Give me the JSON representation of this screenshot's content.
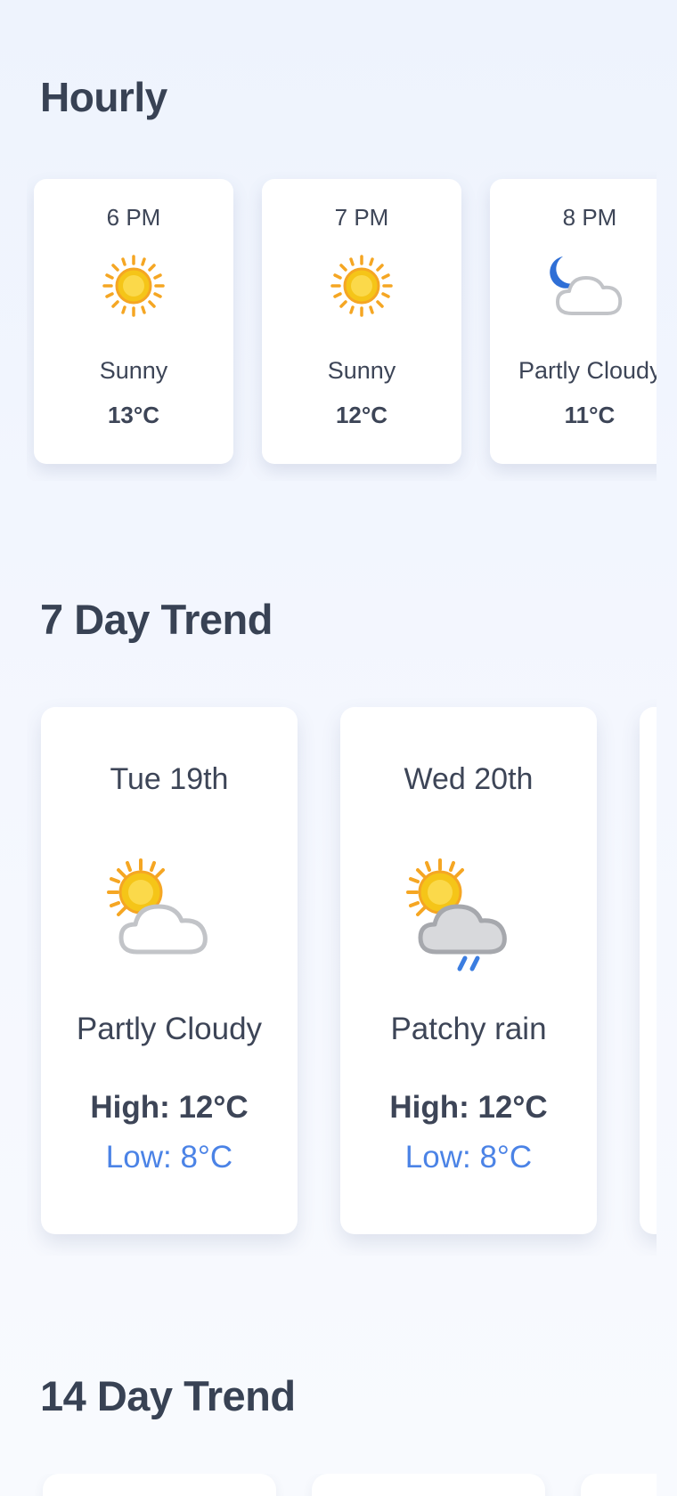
{
  "hourly": {
    "title": "Hourly",
    "items": [
      {
        "time": "6 PM",
        "condition": "Sunny",
        "temp": "13°C",
        "icon": "sun-icon"
      },
      {
        "time": "7 PM",
        "condition": "Sunny",
        "temp": "12°C",
        "icon": "sun-icon"
      },
      {
        "time": "8 PM",
        "condition": "Partly Cloudy",
        "temp": "11°C",
        "icon": "moon-cloud-icon"
      }
    ]
  },
  "seven_day": {
    "title": "7 Day Trend",
    "items": [
      {
        "date": "Tue 19th",
        "condition": "Partly Cloudy",
        "high": "High: 12°C",
        "low": "Low: 8°C",
        "icon": "sun-cloud-icon"
      },
      {
        "date": "Wed 20th",
        "condition": "Patchy rain",
        "high": "High: 12°C",
        "low": "Low: 8°C",
        "icon": "sun-cloud-rain-icon"
      }
    ]
  },
  "fourteen_day": {
    "title": "14 Day Trend"
  },
  "colors": {
    "background": "#eef3fd",
    "card": "#ffffff",
    "text": "#3d4557",
    "low_temp": "#4b83e6",
    "sun": "#f5c518",
    "moon": "#2f6fd6",
    "rain": "#3b7de0"
  }
}
